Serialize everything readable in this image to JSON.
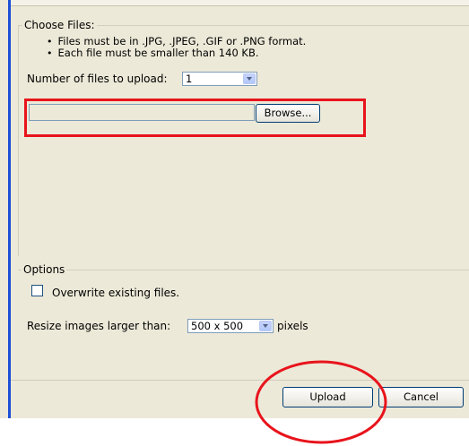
{
  "choose_files": {
    "legend": "Choose Files:",
    "rules": [
      "Files must be in .JPG, .JPEG, .GIF or .PNG format.",
      "Each file must be smaller than 140 KB."
    ],
    "count_label": "Number of files to upload:",
    "count_value": "1",
    "browse_label": "Browse...",
    "file_value": ""
  },
  "options": {
    "legend": "Options",
    "overwrite_label": "Overwrite existing files.",
    "overwrite_checked": false,
    "resize_label": "Resize images larger than:",
    "resize_value": "500 x 500",
    "resize_unit": "pixels"
  },
  "buttons": {
    "upload": "Upload",
    "cancel": "Cancel"
  },
  "annotations": {
    "color": "#e8141c"
  },
  "colors": {
    "dialog_bg": "#ece9d8",
    "accent_bar": "#1c4fd6",
    "field_border": "#7f9db9"
  }
}
